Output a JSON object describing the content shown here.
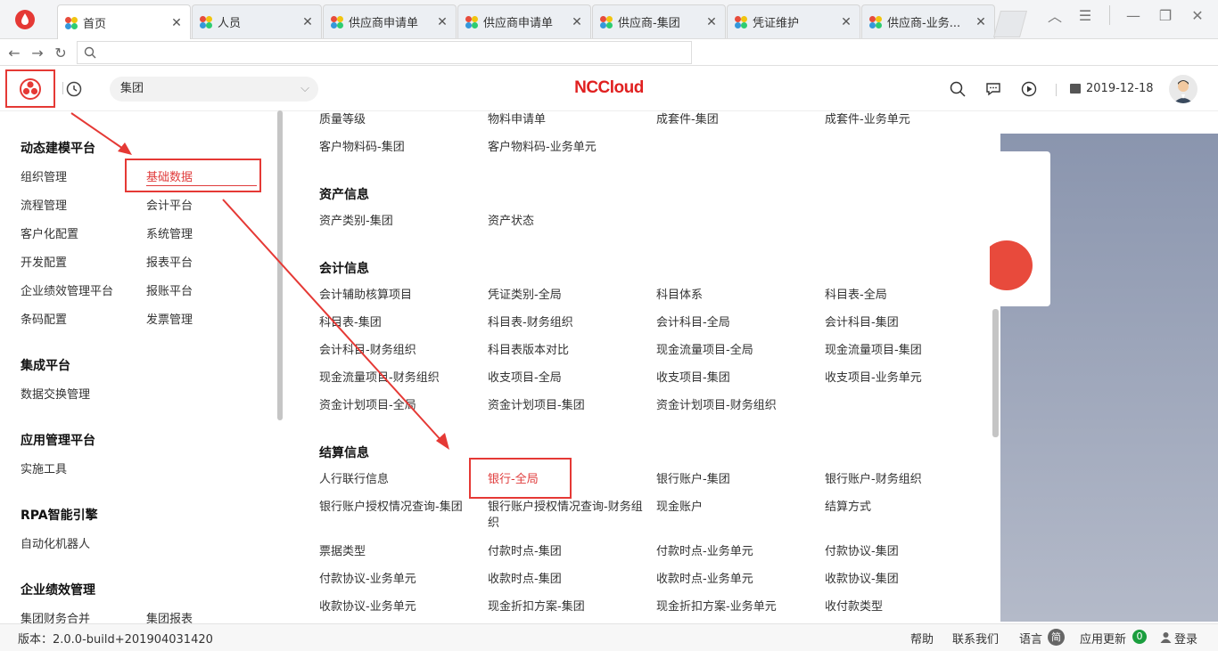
{
  "browser": {
    "tabs": [
      {
        "label": "首页"
      },
      {
        "label": "人员"
      },
      {
        "label": "供应商申请单"
      },
      {
        "label": "供应商申请单"
      },
      {
        "label": "供应商-集团"
      },
      {
        "label": "凭证维护"
      },
      {
        "label": "供应商-业务..."
      }
    ],
    "address_value": ""
  },
  "header": {
    "org_select": "集团",
    "brand": "NCCloud",
    "date": "2019-12-18"
  },
  "left_nav": {
    "sections": [
      {
        "title": "动态建模平台",
        "items": [
          "组织管理",
          "基础数据",
          "流程管理",
          "会计平台",
          "客户化配置",
          "系统管理",
          "开发配置",
          "报表平台",
          "企业绩效管理平台",
          "报账平台",
          "条码配置",
          "发票管理"
        ]
      },
      {
        "title": "集成平台",
        "items": [
          "数据交换管理"
        ]
      },
      {
        "title": "应用管理平台",
        "items": [
          "实施工具"
        ]
      },
      {
        "title": "RPA智能引擎",
        "items": [
          "自动化机器人"
        ]
      },
      {
        "title": "企业绩效管理",
        "items": [
          "集团财务合并",
          "集团报表"
        ]
      }
    ]
  },
  "content": {
    "top_items": [
      "质量等级",
      "物料申请单",
      "成套件-集团",
      "成套件-业务单元",
      "客户物料码-集团",
      "客户物料码-业务单元"
    ],
    "groups": [
      {
        "title": "资产信息",
        "items": [
          "资产类别-集团",
          "资产状态"
        ]
      },
      {
        "title": "会计信息",
        "items": [
          "会计辅助核算项目",
          "凭证类别-全局",
          "科目体系",
          "科目表-全局",
          "科目表-集团",
          "科目表-财务组织",
          "会计科目-全局",
          "会计科目-集团",
          "会计科目-财务组织",
          "科目表版本对比",
          "现金流量项目-全局",
          "现金流量项目-集团",
          "现金流量项目-财务组织",
          "收支项目-全局",
          "收支项目-集团",
          "收支项目-业务单元",
          "资金计划项目-全局",
          "资金计划项目-集团",
          "资金计划项目-财务组织"
        ]
      },
      {
        "title": "结算信息",
        "items": [
          "人行联行信息",
          "银行-全局",
          "银行账户-集团",
          "银行账户-财务组织",
          "银行账户授权情况查询-集团",
          "银行账户授权情况查询-财务组织",
          "现金账户",
          "结算方式",
          "票据类型",
          "付款时点-集团",
          "付款时点-业务单元",
          "付款协议-集团",
          "付款协议-业务单元",
          "收款时点-集团",
          "收款时点-业务单元",
          "收款协议-集团",
          "收款协议-业务单元",
          "现金折扣方案-集团",
          "现金折扣方案-业务单元",
          "收付款类型"
        ]
      }
    ]
  },
  "footer": {
    "version": "版本：2.0.0-build+201904031420",
    "help": "帮助",
    "contact": "联系我们",
    "language": "语言",
    "language_badge": "简",
    "updates": "应用更新",
    "updates_count": "0",
    "login": "登录"
  },
  "colors": {
    "accent": "#e03c3c",
    "brand": "#e02020",
    "annotation": "#e53935"
  }
}
